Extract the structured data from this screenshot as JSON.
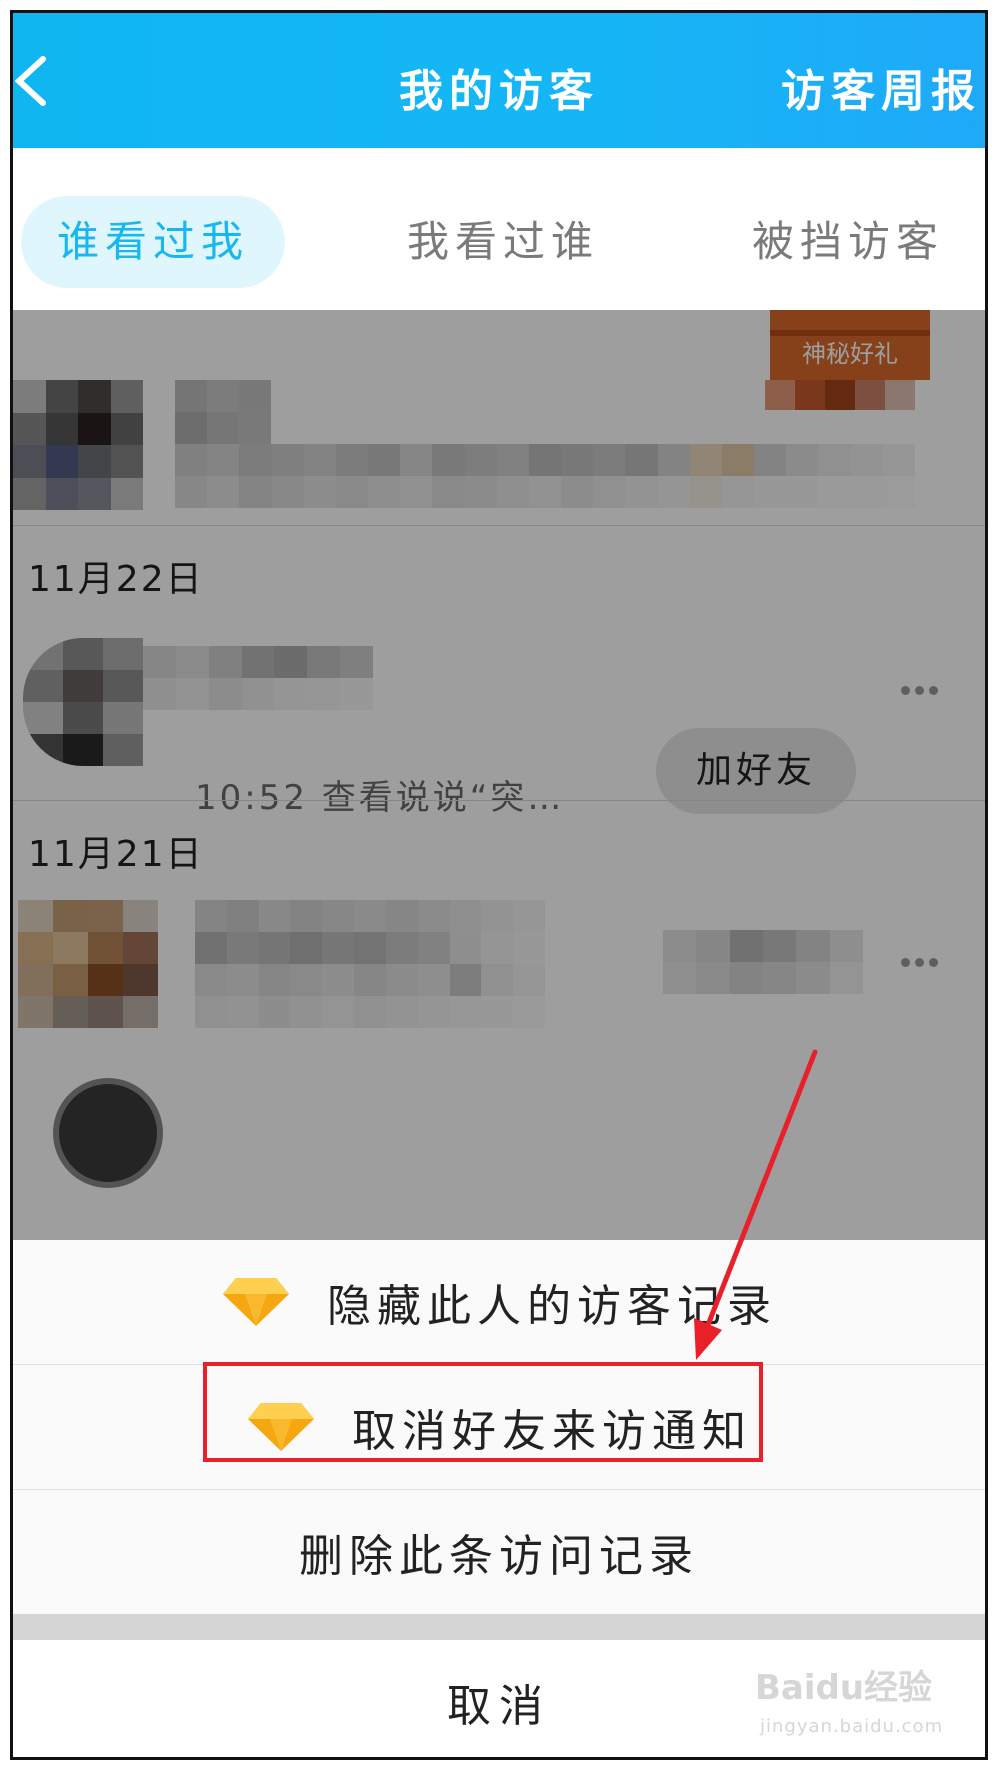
{
  "header": {
    "title": "我的访客",
    "weekly_report": "访客周报"
  },
  "tabs": [
    {
      "label": "谁看过我",
      "active": true
    },
    {
      "label": "我看过谁",
      "active": false
    },
    {
      "label": "被挡访客",
      "active": false
    }
  ],
  "list": {
    "dates": [
      "11月22日",
      "11月21日"
    ],
    "visit_info": "10:52 查看说说“突…",
    "add_friend_label": "加好友",
    "gift_badge_text": "神秘好礼"
  },
  "action_sheet": {
    "hide_record": "隐藏此人的访客记录",
    "cancel_notify": "取消好友来访通知",
    "delete_record": "删除此条访问记录",
    "cancel": "取消"
  },
  "colors": {
    "header_start": "#0fb6f0",
    "header_end": "#1fa9f8",
    "tab_active_text": "#18b7ef",
    "tab_active_bg": "#dff6fd",
    "highlight": "#e8202a",
    "diamond": "#f6a70f"
  },
  "watermark": {
    "brand": "Baidu经验",
    "url": "jingyan.baidu.com"
  }
}
